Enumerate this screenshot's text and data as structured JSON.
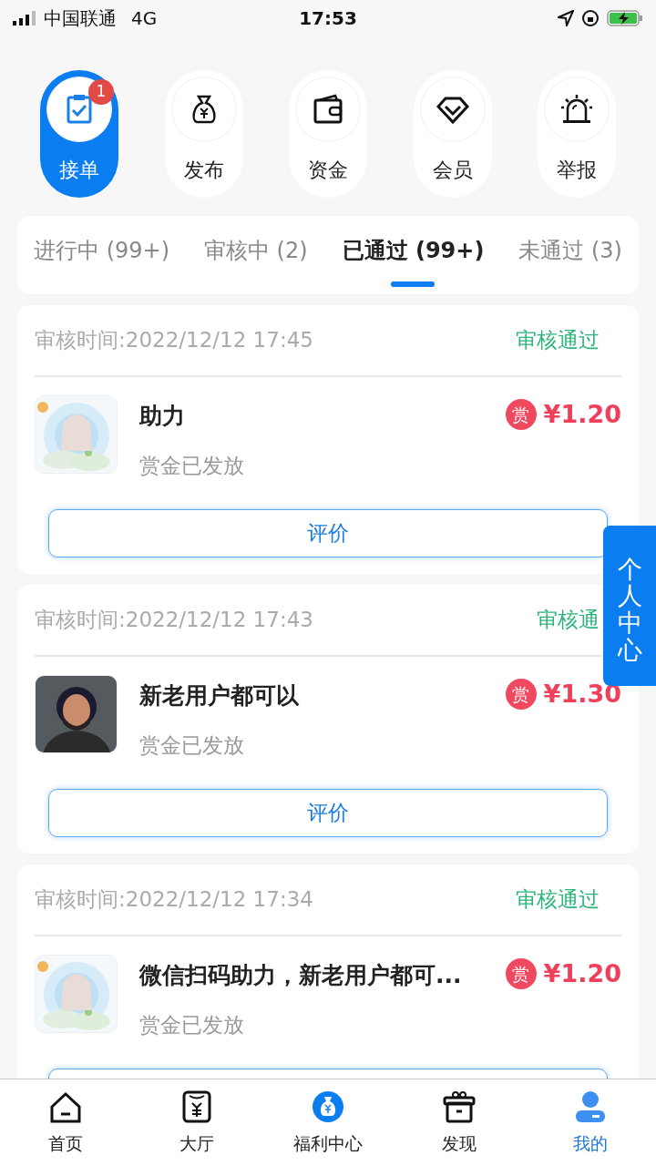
{
  "status_bar": {
    "carrier": "中国联通",
    "network": "4G",
    "time": "17:53"
  },
  "actions": [
    {
      "label": "接单",
      "selected": true,
      "badge": "1",
      "kind": "task"
    },
    {
      "label": "发布",
      "selected": false,
      "kind": "bag"
    },
    {
      "label": "资金",
      "selected": false,
      "kind": "wallet"
    },
    {
      "label": "会员",
      "selected": false,
      "kind": "diamond"
    },
    {
      "label": "举报",
      "selected": false,
      "kind": "alarm"
    }
  ],
  "tabs": [
    {
      "label": "进行中 (99+)",
      "selected": false
    },
    {
      "label": "审核中 (2)",
      "selected": false
    },
    {
      "label": "已通过 (99+)",
      "selected": true
    },
    {
      "label": "未通过 (3)",
      "selected": false
    }
  ],
  "orders": [
    {
      "time": "审核时间:2022/12/12 17:45",
      "status": "审核通过",
      "title": "助力",
      "subtitle": "赏金已发放",
      "reward_tag": "赏",
      "price": "¥1.20",
      "button": "评价"
    },
    {
      "time": "审核时间:2022/12/12 17:43",
      "status": "审核通",
      "title": "新老用户都可以",
      "subtitle": "赏金已发放",
      "reward_tag": "赏",
      "price": "¥1.30",
      "button": "评价",
      "image": {
        "kind": "avatar"
      }
    },
    {
      "time": "审核时间:2022/12/12 17:34",
      "status": "审核通过",
      "title": "微信扫码助力，新老用户都可...",
      "subtitle": "赏金已发放",
      "reward_tag": "赏",
      "price": "¥1.20"
    }
  ],
  "float_tab": "个人中心",
  "bottom_nav": [
    {
      "label": "首页",
      "selected": false,
      "kind": "home"
    },
    {
      "label": "大厅",
      "selected": false,
      "kind": "hall"
    },
    {
      "label": "福利中心",
      "selected": false,
      "kind": "welfare"
    },
    {
      "label": "发现",
      "selected": false,
      "kind": "discover"
    },
    {
      "label": "我的",
      "selected": true,
      "kind": "me"
    }
  ]
}
